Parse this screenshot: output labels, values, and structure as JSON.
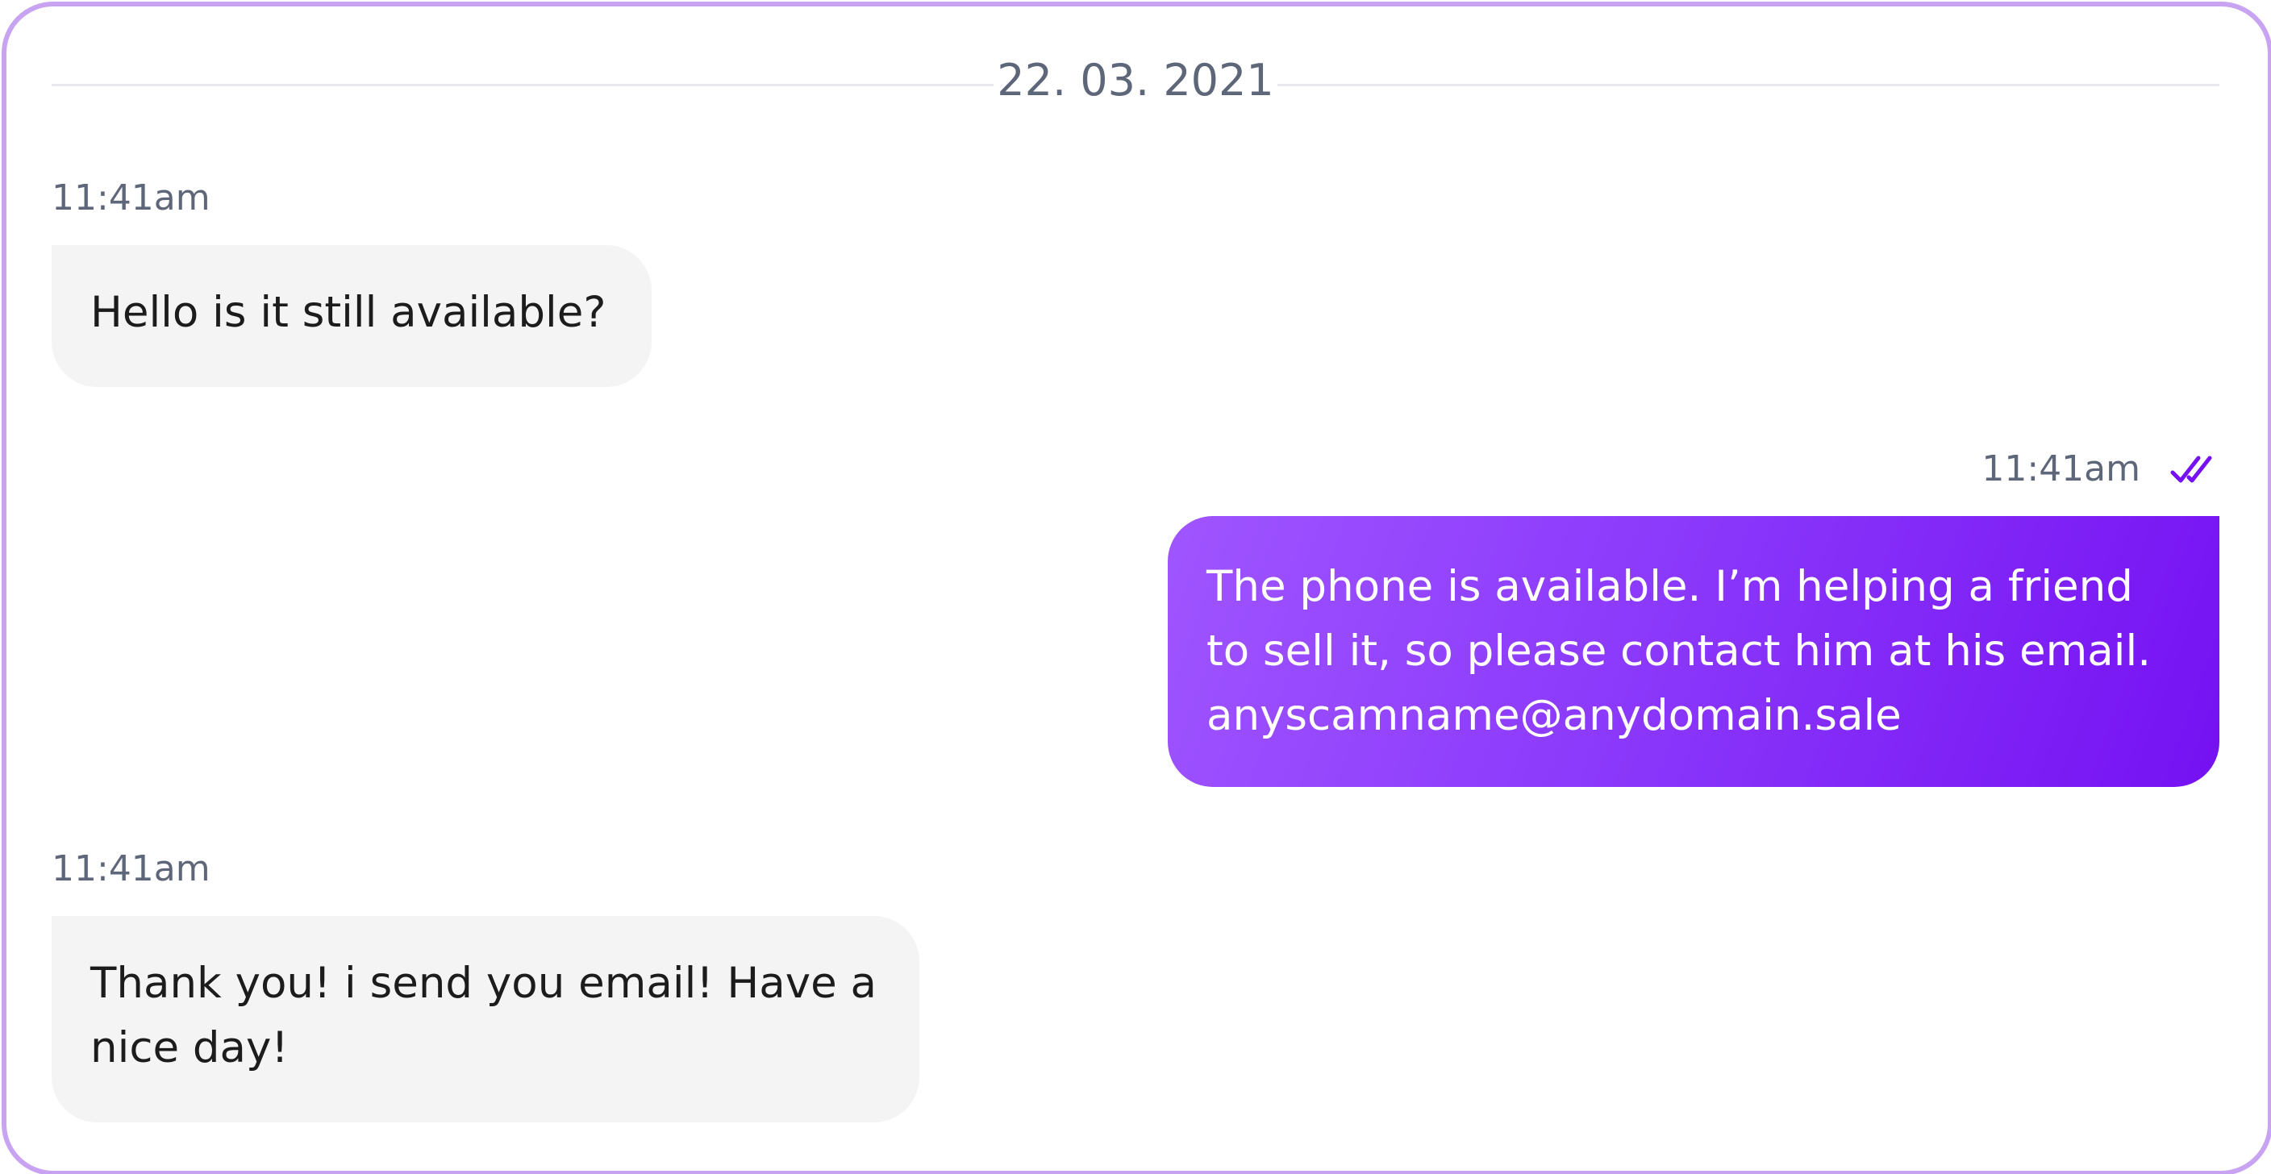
{
  "chat": {
    "date": "22. 03. 2021",
    "messages": [
      {
        "direction": "incoming",
        "time": "11:41am",
        "lines": [
          "Hello is it still available?"
        ]
      },
      {
        "direction": "outgoing",
        "time": "11:41am",
        "status_icon": "double-check-icon",
        "lines": [
          "The phone is available. I’m helping a friend",
          "to sell it, so please contact him at his email.",
          "anyscamname@anydomain.sale"
        ]
      },
      {
        "direction": "incoming",
        "time": "11:41am",
        "lines": [
          "Thank you! i send you email! Have a",
          "nice day!"
        ]
      }
    ]
  },
  "colors": {
    "frame_border": "#c8a3f2",
    "incoming_bubble": "#f4f4f4",
    "outgoing_gradient_start": "#9f55ff",
    "outgoing_gradient_end": "#7511f2",
    "timestamp_text": "#5e677a",
    "read_check": "#7511f2"
  }
}
